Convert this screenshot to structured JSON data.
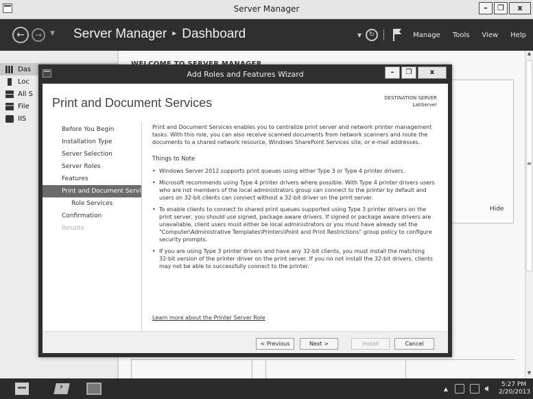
{
  "window": {
    "title": "Server Manager",
    "controls": {
      "minimize": "–",
      "maximize": "❐",
      "close": "x"
    }
  },
  "header": {
    "breadcrumb_root": "Server Manager",
    "breadcrumb_sep": "▸",
    "breadcrumb_page": "Dashboard",
    "menu": [
      "Manage",
      "Tools",
      "View",
      "Help"
    ]
  },
  "sidebar": {
    "items": [
      {
        "label": "Das",
        "icon": "dashboard-icon"
      },
      {
        "label": "Loc",
        "icon": "local-server-icon"
      },
      {
        "label": "All S",
        "icon": "all-servers-icon"
      },
      {
        "label": "File",
        "icon": "file-storage-icon"
      },
      {
        "label": "IIS",
        "icon": "iis-icon"
      }
    ]
  },
  "main": {
    "welcome": "WELCOME TO SERVER MANAGER",
    "hide_label": "Hide"
  },
  "wizard": {
    "title": "Add Roles and Features Wizard",
    "heading": "Print and Document Services",
    "destination_label": "DESTINATION SERVER",
    "destination_value": "LabServer",
    "steps": [
      {
        "label": "Before You Begin",
        "state": "normal"
      },
      {
        "label": "Installation Type",
        "state": "normal"
      },
      {
        "label": "Server Selection",
        "state": "normal"
      },
      {
        "label": "Server Roles",
        "state": "normal"
      },
      {
        "label": "Features",
        "state": "normal"
      },
      {
        "label": "Print and Document Servi...",
        "state": "active"
      },
      {
        "label": "Role Services",
        "state": "sub"
      },
      {
        "label": "Confirmation",
        "state": "normal"
      },
      {
        "label": "Results",
        "state": "disabled"
      }
    ],
    "intro": "Print and Document Services enables you to centralize print server and network printer management tasks. With this role, you can also receive scanned documents from network scanners and route the documents to a shared network resource, Windows SharePoint Services site, or e-mail addresses.",
    "things_to_note": "Things to Note",
    "notes": [
      "Windows Server 2012 supports print queues using either Type 3 or Type 4 printer drivers.",
      "Microsoft recommends using Type 4 printer drivers where possible. With Type 4 printer drivers users who are not members of the local administrators group can connect to the printer by default and users on 32-bit clients can connect without a 32-bit driver on the print server.",
      "To enable clients to connect to shared print queues supported using Type 3 printer drivers on the print server, you should use signed, package aware drivers. If signed or package aware drivers are unavailable, client users must either be local administrators or you must have already set the \"Computer\\Administrative Templates\\Printers\\Point and Print Restrictions\" group policy to configure security prompts.",
      "If you are using Type 3 printer drivers and have any 32-bit clients, you must install the matching 32-bit version of the printer driver on the print server. If you no not install the 32-bit drivers, clients may not be able to successfully connect to the printer."
    ],
    "learn_more": "Learn more about the Printer Server Role",
    "buttons": {
      "previous": "< Previous",
      "next": "Next >",
      "install": "Install",
      "cancel": "Cancel"
    }
  },
  "taskbar": {
    "clock_time": "5:27 PM",
    "clock_date": "2/20/2013"
  }
}
